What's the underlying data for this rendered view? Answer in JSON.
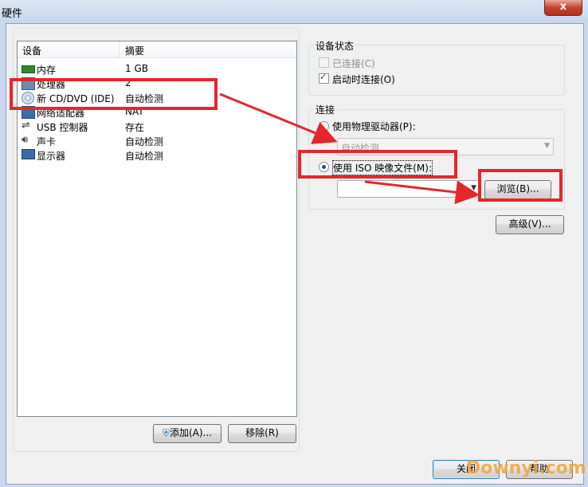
{
  "window": {
    "title": "硬件",
    "close_glyph": "x"
  },
  "device_list": {
    "columns": [
      "设备",
      "摘要"
    ],
    "rows": [
      {
        "name": "内存",
        "summary": "1 GB",
        "icon": "memory-icon"
      },
      {
        "name": "处理器",
        "summary": "2",
        "icon": "processor-icon"
      },
      {
        "name": "新 CD/DVD (IDE)",
        "summary": "自动检测",
        "icon": "cd-dvd-icon"
      },
      {
        "name": "网络适配器",
        "summary": "NAT",
        "icon": "network-adapter-icon"
      },
      {
        "name": "USB 控制器",
        "summary": "存在",
        "icon": "usb-icon"
      },
      {
        "name": "声卡",
        "summary": "自动检测",
        "icon": "sound-card-icon"
      },
      {
        "name": "显示器",
        "summary": "自动检测",
        "icon": "display-icon"
      }
    ]
  },
  "buttons": {
    "add": "添加(A)...",
    "remove": "移除(R)",
    "browse": "浏览(B)...",
    "advanced": "高级(V)...",
    "close": "关闭",
    "help": "帮助"
  },
  "device_status": {
    "label": "设备状态",
    "connected": "已连接(C)",
    "connect_at_power_on": "启动时连接(O)"
  },
  "connection": {
    "label": "连接",
    "use_physical_drive": "使用物理驱动器(P):",
    "physical_drive_value": "自动检测",
    "use_iso": "使用 ISO 映像文件(M):",
    "iso_path": ""
  },
  "watermark": "Downyi.com",
  "colors": {
    "annotation_red": "#e5262a",
    "window_frame": "#c9d9ee"
  }
}
